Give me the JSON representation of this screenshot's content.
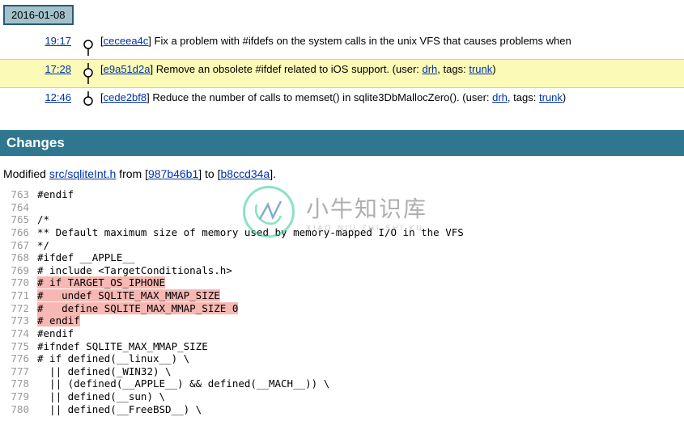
{
  "date": "2016-01-08",
  "timeline": [
    {
      "time": "19:17",
      "hash": "ceceea4c",
      "msg_tpl": "Fix a problem with #ifdefs on the system calls in the unix VFS that causes problems when"
    },
    {
      "time": "17:28",
      "hash": "e9a51d2a",
      "msg_tpl": "Remove an obsolete #ifdef related to iOS support. (user: {user}, tags: {tags})",
      "user": "drh",
      "tags": "trunk",
      "highlight": true
    },
    {
      "time": "12:46",
      "hash": "cede2bf8",
      "msg_tpl": "Reduce the number of calls to memset() in sqlite3DbMallocZero(). (user: {user}, tags: {tags})",
      "user": "drh",
      "tags": "trunk"
    }
  ],
  "changes_heading": "Changes",
  "modified": {
    "prefix": "Modified ",
    "file": "src/sqliteInt.h",
    "mid1": " from [",
    "hash_from": "987b46b1",
    "mid2": "] to [",
    "hash_to": "b8ccd34a",
    "suffix": "]."
  },
  "diff": [
    {
      "n": 763,
      "t": "#endif"
    },
    {
      "n": 764,
      "t": ""
    },
    {
      "n": 765,
      "t": "/*"
    },
    {
      "n": 766,
      "t": "** Default maximum size of memory used by memory-mapped I/O in the VFS"
    },
    {
      "n": 767,
      "t": "*/"
    },
    {
      "n": 768,
      "t": "#ifdef __APPLE__"
    },
    {
      "n": 769,
      "t": "# include <TargetConditionals.h>"
    },
    {
      "n": 770,
      "t": "# if TARGET_OS_IPHONE",
      "rm": true
    },
    {
      "n": 771,
      "t": "#   undef SQLITE_MAX_MMAP_SIZE",
      "rm": true
    },
    {
      "n": 772,
      "t": "#   define SQLITE_MAX_MMAP_SIZE 0",
      "rm": true
    },
    {
      "n": 773,
      "t": "# endif",
      "rm": true
    },
    {
      "n": 774,
      "t": "#endif"
    },
    {
      "n": 775,
      "t": "#ifndef SQLITE_MAX_MMAP_SIZE"
    },
    {
      "n": 776,
      "t": "# if defined(__linux__) \\"
    },
    {
      "n": 777,
      "t": "  || defined(_WIN32) \\"
    },
    {
      "n": 778,
      "t": "  || (defined(__APPLE__) && defined(__MACH__)) \\"
    },
    {
      "n": 779,
      "t": "  || defined(__sun) \\"
    },
    {
      "n": 780,
      "t": "  || defined(__FreeBSD__) \\"
    }
  ],
  "watermark": {
    "cn": "小牛知识库",
    "py": "XIAO NIU ZHI SHI KU"
  }
}
